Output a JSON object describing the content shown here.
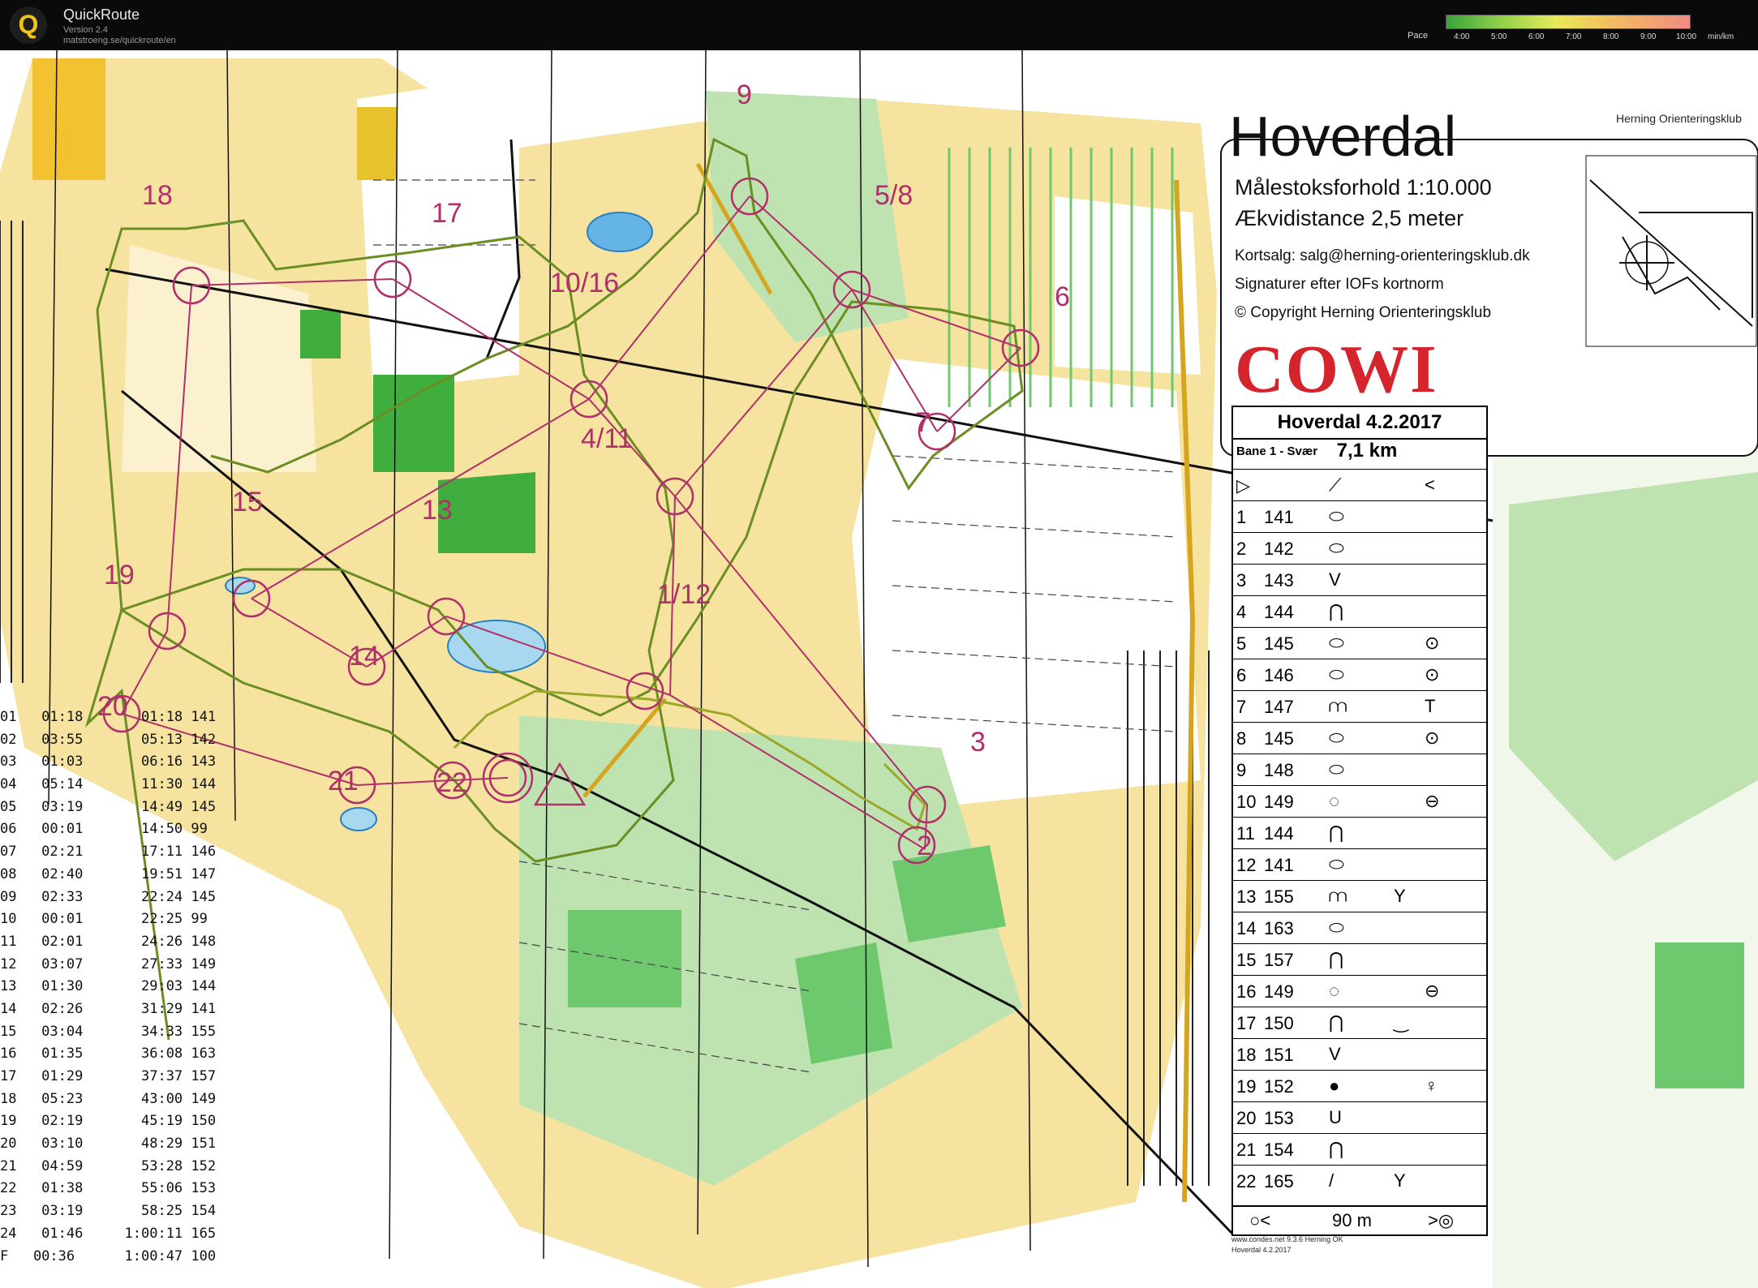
{
  "app": {
    "name": "QuickRoute",
    "version": "Version 2.4",
    "url": "matstroeng.se/quickroute/en",
    "logo_letter": "Q"
  },
  "pace": {
    "label": "Pace",
    "ticks": [
      "4:00",
      "5:00",
      "6:00",
      "7:00",
      "8:00",
      "9:00",
      "10:00"
    ],
    "unit": "min/km"
  },
  "map": {
    "title": "Hoverdal",
    "scale": "Målestoksforhold 1:10.000",
    "equidistance": "Ækvidistance 2,5 meter",
    "sales": "Kortsalg: salg@herning-orienteringsklub.dk",
    "signs": "Signaturer efter IOFs kortnorm",
    "copyright": "© Copyright Herning Orienteringsklub",
    "sponsor": "COWI",
    "club": "Herning Orienteringsklub",
    "condes": "www.condes.net 9.3.6 Herning OK",
    "condes_date": "Hoverdal 4.2.2017",
    "colors": {
      "open": "#f6e3a0",
      "forest": "#ffffff",
      "green": "#6ec96e",
      "lightgreen": "#bfe3b0",
      "route": "#b0306a",
      "water": "#a8d8f0"
    },
    "control_labels": [
      "9",
      "18",
      "17",
      "5/8",
      "10/16",
      "6",
      "4/11",
      "7",
      "13",
      "15",
      "19",
      "1/12",
      "14",
      "20",
      "21",
      "22",
      "3",
      "2"
    ]
  },
  "control_card": {
    "header": "Hoverdal 4.2.2017",
    "course": "Bane 1 - Svær",
    "length": "7,1 km",
    "rows": [
      {
        "n": "1",
        "code": "141",
        "feature": "⬭",
        "extra": "",
        "pos": ""
      },
      {
        "n": "2",
        "code": "142",
        "feature": "⬭",
        "extra": "",
        "pos": ""
      },
      {
        "n": "3",
        "code": "143",
        "feature": "V",
        "extra": "",
        "pos": ""
      },
      {
        "n": "4",
        "code": "144",
        "feature": "⋂",
        "extra": "",
        "pos": ""
      },
      {
        "n": "5",
        "code": "145",
        "feature": "⬭",
        "extra": "",
        "pos": "⊙"
      },
      {
        "n": "6",
        "code": "146",
        "feature": "⬭",
        "extra": "",
        "pos": "⊙"
      },
      {
        "n": "7",
        "code": "147",
        "feature": "⩋",
        "extra": "",
        "pos": "T"
      },
      {
        "n": "8",
        "code": "145",
        "feature": "⬭",
        "extra": "",
        "pos": "⊙"
      },
      {
        "n": "9",
        "code": "148",
        "feature": "⬭",
        "extra": "",
        "pos": ""
      },
      {
        "n": "10",
        "code": "149",
        "feature": "◌",
        "extra": "",
        "pos": "⊖"
      },
      {
        "n": "11",
        "code": "144",
        "feature": "⋂",
        "extra": "",
        "pos": ""
      },
      {
        "n": "12",
        "code": "141",
        "feature": "⬭",
        "extra": "",
        "pos": ""
      },
      {
        "n": "13",
        "code": "155",
        "feature": "⩋",
        "extra": "Y",
        "pos": ""
      },
      {
        "n": "14",
        "code": "163",
        "feature": "⬭",
        "extra": "",
        "pos": ""
      },
      {
        "n": "15",
        "code": "157",
        "feature": "⋂",
        "extra": "",
        "pos": ""
      },
      {
        "n": "16",
        "code": "149",
        "feature": "◌",
        "extra": "",
        "pos": "⊖"
      },
      {
        "n": "17",
        "code": "150",
        "feature": "⋂",
        "extra": "‿",
        "pos": ""
      },
      {
        "n": "18",
        "code": "151",
        "feature": "V",
        "extra": "",
        "pos": ""
      },
      {
        "n": "19",
        "code": "152",
        "feature": "●",
        "extra": "",
        "pos": "♀"
      },
      {
        "n": "20",
        "code": "153",
        "feature": "U",
        "extra": "",
        "pos": ""
      },
      {
        "n": "21",
        "code": "154",
        "feature": "⋂",
        "extra": "",
        "pos": ""
      },
      {
        "n": "22",
        "code": "165",
        "feature": "/",
        "extra": "Y",
        "pos": ""
      }
    ],
    "footer_distance": "90 m"
  },
  "splits": [
    [
      "01",
      "01:18",
      "01:18",
      "141"
    ],
    [
      "02",
      "03:55",
      "05:13",
      "142"
    ],
    [
      "03",
      "01:03",
      "06:16",
      "143"
    ],
    [
      "04",
      "05:14",
      "11:30",
      "144"
    ],
    [
      "05",
      "03:19",
      "14:49",
      "145"
    ],
    [
      "06",
      "00:01",
      "14:50",
      "99"
    ],
    [
      "07",
      "02:21",
      "17:11",
      "146"
    ],
    [
      "08",
      "02:40",
      "19:51",
      "147"
    ],
    [
      "09",
      "02:33",
      "22:24",
      "145"
    ],
    [
      "10",
      "00:01",
      "22:25",
      "99"
    ],
    [
      "11",
      "02:01",
      "24:26",
      "148"
    ],
    [
      "12",
      "03:07",
      "27:33",
      "149"
    ],
    [
      "13",
      "01:30",
      "29:03",
      "144"
    ],
    [
      "14",
      "02:26",
      "31:29",
      "141"
    ],
    [
      "15",
      "03:04",
      "34:33",
      "155"
    ],
    [
      "16",
      "01:35",
      "36:08",
      "163"
    ],
    [
      "17",
      "01:29",
      "37:37",
      "157"
    ],
    [
      "18",
      "05:23",
      "43:00",
      "149"
    ],
    [
      "19",
      "02:19",
      "45:19",
      "150"
    ],
    [
      "20",
      "03:10",
      "48:29",
      "151"
    ],
    [
      "21",
      "04:59",
      "53:28",
      "152"
    ],
    [
      "22",
      "01:38",
      "55:06",
      "153"
    ],
    [
      "23",
      "03:19",
      "58:25",
      "154"
    ],
    [
      "24",
      "01:46",
      "1:00:11",
      "165"
    ],
    [
      "F",
      "00:36",
      "1:00:47",
      "100"
    ]
  ]
}
